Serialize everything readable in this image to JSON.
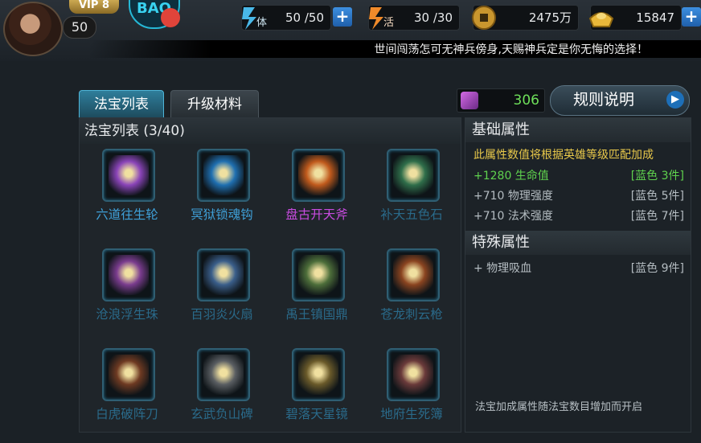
{
  "player": {
    "vip": "VIP 8",
    "level": "50",
    "logo_text": "BAO"
  },
  "resources": {
    "stamina": {
      "value": "50 /50",
      "icon": "stamina-icon",
      "glyph": "体"
    },
    "vigor": {
      "value": "30 /30",
      "icon": "vigor-icon",
      "glyph": "活"
    },
    "copper": {
      "value": "2475万",
      "icon": "coin-icon"
    },
    "gold": {
      "value": "15847",
      "icon": "gold-ingot-icon"
    }
  },
  "ticker": "世间闯荡怎可无神兵傍身,天赐神兵定是你无悔的选择！",
  "tabs": [
    {
      "label": "法宝列表",
      "active": true
    },
    {
      "label": "升级材料",
      "active": false
    }
  ],
  "gem_count": "306",
  "rules_button": "规则说明",
  "list": {
    "title": "法宝列表 (3/40)",
    "items": [
      {
        "name": "六道往生轮",
        "color": "#3fa0d8",
        "icon": "golden-scepter-icon",
        "art": "#8a44b8"
      },
      {
        "name": "冥狱锁魂钩",
        "color": "#3fa0d8",
        "icon": "soul-hook-icon",
        "art": "#1f6fb0"
      },
      {
        "name": "盘古开天斧",
        "color": "#c84be0",
        "icon": "axe-icon",
        "art": "#c05a1c"
      },
      {
        "name": "补天五色石",
        "color": "#2a6a8a",
        "icon": "five-color-stone-icon",
        "art": "#2f6e4a"
      },
      {
        "name": "沧浪浮生珠",
        "color": "#2a6a8a",
        "icon": "pearl-pot-icon",
        "art": "#7a3c8e"
      },
      {
        "name": "百羽炎火扇",
        "color": "#2a6a8a",
        "icon": "feather-fan-icon",
        "art": "#3a5e8a"
      },
      {
        "name": "禹王镇国鼎",
        "color": "#2a6a8a",
        "icon": "cauldron-icon",
        "art": "#4d6e3a"
      },
      {
        "name": "苍龙刺云枪",
        "color": "#2a6a8a",
        "icon": "dragon-spear-icon",
        "art": "#8a4420"
      },
      {
        "name": "白虎破阵刀",
        "color": "#2a6a8a",
        "icon": "blade-icon",
        "art": "#6e3a22"
      },
      {
        "name": "玄武负山碑",
        "color": "#2a6a8a",
        "icon": "stone-tablet-icon",
        "art": "#5a5e62"
      },
      {
        "name": "碧落天星镜",
        "color": "#2a6a8a",
        "icon": "star-mirror-icon",
        "art": "#6a5a2a"
      },
      {
        "name": "地府生死簿",
        "color": "#2a6a8a",
        "icon": "book-icon",
        "art": "#6a3a3a"
      }
    ]
  },
  "attributes": {
    "base_title": "基础属性",
    "base_note": "此属性数值将根据英雄等级匹配加成",
    "base_rows": [
      {
        "label": "+1280 生命值",
        "req": "[蓝色 3件]",
        "color": "#5fd24e"
      },
      {
        "label": "+710 物理强度",
        "req": "[蓝色 5件]",
        "color": "#b4bcc1"
      },
      {
        "label": "+710 法术强度",
        "req": "[蓝色 7件]",
        "color": "#b4bcc1"
      }
    ],
    "special_title": "特殊属性",
    "special_rows": [
      {
        "label": "+ 物理吸血",
        "req": "[蓝色 9件]",
        "color": "#b4bcc1"
      }
    ],
    "footnote": "法宝加成属性随法宝数目增加而开启"
  },
  "colors": {
    "accent_blue": "#3fa0d8",
    "active_green": "#5fd24e",
    "note_yellow": "#e8c84a"
  }
}
